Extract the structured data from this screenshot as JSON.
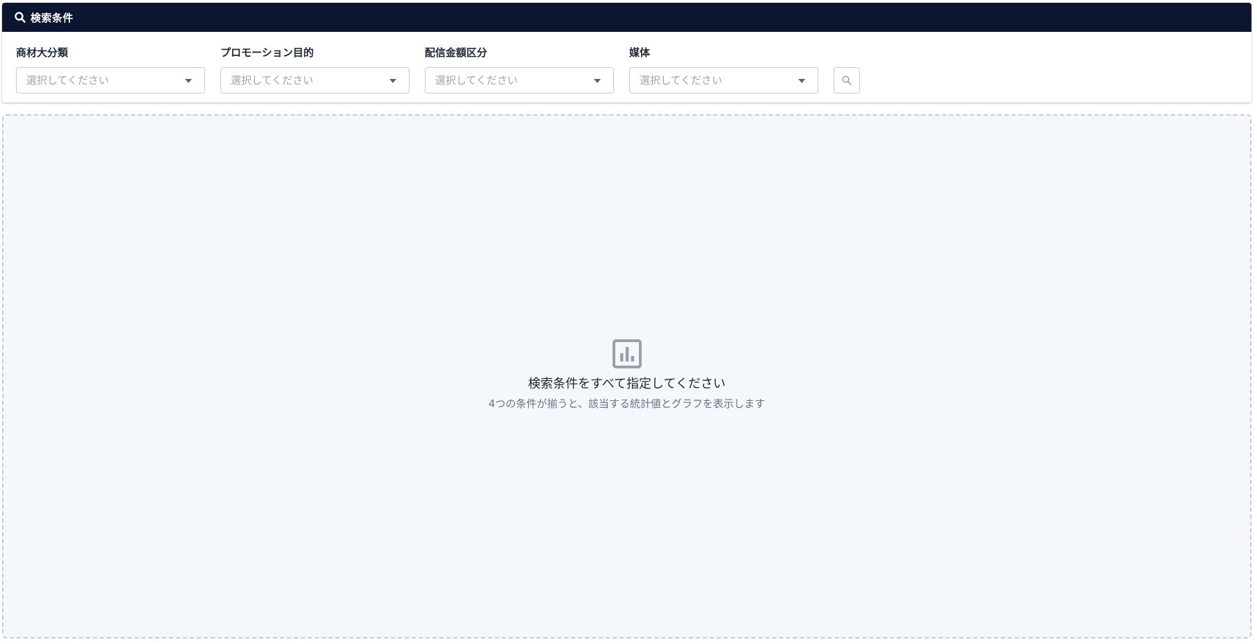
{
  "header": {
    "title": "検索条件",
    "icon": "search-icon",
    "background": "#0c1630"
  },
  "filters": [
    {
      "label": "商材大分類",
      "placeholder": "選択してください"
    },
    {
      "label": "プロモーション目的",
      "placeholder": "選択してください"
    },
    {
      "label": "配信金額区分",
      "placeholder": "選択してください"
    },
    {
      "label": "媒体",
      "placeholder": "選択してください"
    }
  ],
  "search_button": {
    "icon": "search-icon"
  },
  "empty_state": {
    "icon": "bar-chart-icon",
    "title": "検索条件をすべて指定してください",
    "subtitle": "4つの条件が揃うと、該当する統計値とグラフを表示します"
  }
}
